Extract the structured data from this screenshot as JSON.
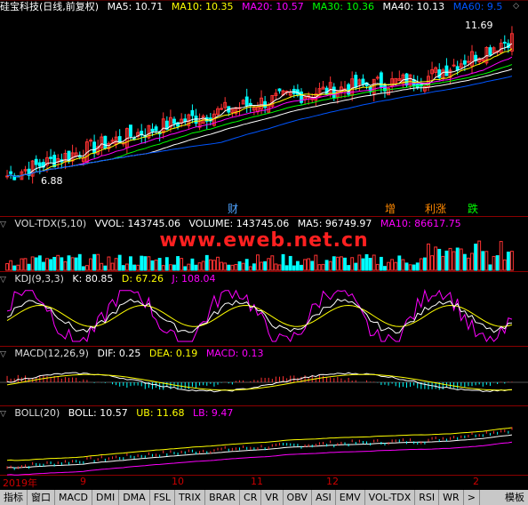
{
  "main": {
    "stock_title": "硅宝科技(日线,前复权)",
    "ma": [
      {
        "label": "MA5: 10.71",
        "color": "#ffffff"
      },
      {
        "label": "MA10: 10.35",
        "color": "#ffff00"
      },
      {
        "label": "MA20: 10.57",
        "color": "#ff00ff"
      },
      {
        "label": "MA30: 10.36",
        "color": "#00ff00"
      },
      {
        "label": "MA40: 10.13",
        "color": "#ffffff"
      },
      {
        "label": "MA60: 9.5",
        "color": "#0055ff"
      }
    ],
    "high_label": "11.69",
    "low_label": "6.88",
    "events": [
      {
        "text": "财",
        "color": "#4fa3ff"
      },
      {
        "text": "增",
        "color": "#ff8800"
      },
      {
        "text": "利涨",
        "color": "#ff8800"
      },
      {
        "text": "跌",
        "color": "#00ff00"
      }
    ]
  },
  "vol": {
    "name": "VOL-TDX(5,10)",
    "vvol": "VVOL: 143745.06",
    "volume": "VOLUME: 143745.06",
    "ma5": "MA5: 96749.97",
    "ma10": "MA10: 86617.75"
  },
  "watermark": "www.eweb.net.cn",
  "kdj": {
    "name": "KDJ(9,3,3)",
    "k": "K: 80.85",
    "d": "D: 67.26",
    "j": "J: 108.04"
  },
  "macd": {
    "name": "MACD(12,26,9)",
    "dif": "DIF: 0.25",
    "dea": "DEA: 0.19",
    "macd": "MACD: 0.13"
  },
  "boll": {
    "name": "BOLL(20)",
    "boll": "BOLL: 10.57",
    "ub": "UB: 11.68",
    "lb": "LB: 9.47"
  },
  "xaxis": [
    "2019年",
    "9",
    "10",
    "11",
    "12",
    "2"
  ],
  "tabs": [
    "指标",
    "窗口",
    "MACD",
    "DMI",
    "DMA",
    "FSL",
    "TRIX",
    "BRAR",
    "CR",
    "VR",
    "OBV",
    "ASI",
    "EMV",
    "VOL-TDX",
    "RSI",
    "WR",
    ">",
    "模板"
  ],
  "colors": {
    "up": "#ff3232",
    "down": "#00ffff",
    "grid": "#8b0000"
  }
}
